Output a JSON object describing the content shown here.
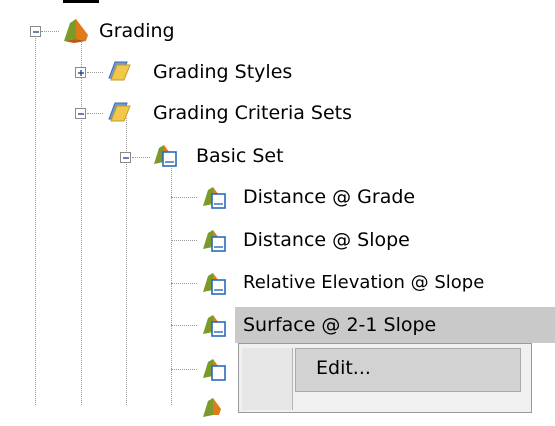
{
  "tree": {
    "root": {
      "label": "Grading",
      "icon": "grading-folder-icon"
    },
    "items": [
      {
        "label": "Grading Styles",
        "icon": "folder-icon",
        "expander": "plus"
      },
      {
        "label": "Grading Criteria Sets",
        "icon": "folder-icon",
        "expander": "minus"
      },
      {
        "label": "Basic Set",
        "icon": "criteria-set-icon",
        "expander": "minus"
      },
      {
        "label": "Distance @ Grade",
        "icon": "criteria-icon"
      },
      {
        "label": "Distance @ Slope",
        "icon": "criteria-icon"
      },
      {
        "label": "Relative Elevation @ Slope",
        "icon": "criteria-icon"
      },
      {
        "label": "Surface @ 2-1 Slope",
        "icon": "criteria-icon",
        "selected": true
      }
    ]
  },
  "context_menu": {
    "items": [
      {
        "label": "Edit..."
      }
    ]
  }
}
